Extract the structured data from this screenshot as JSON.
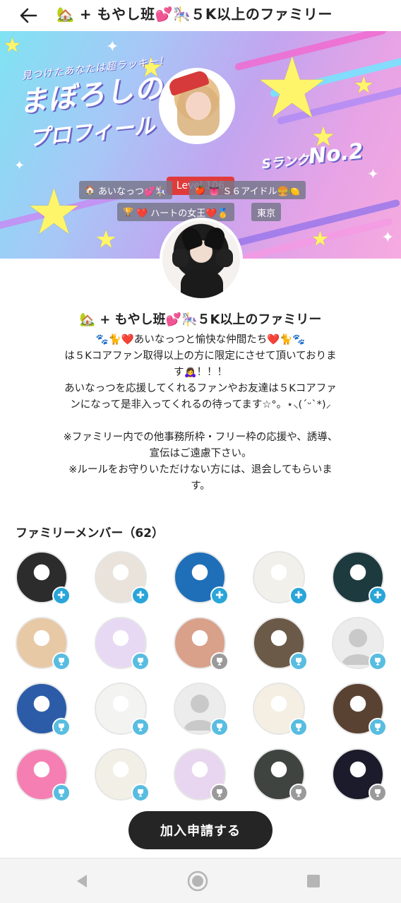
{
  "header": {
    "title": "🏡 + もやし班💕🎠５K以上のファミリー"
  },
  "banner": {
    "subtitle": "見つけたあなたは超ラッキー！",
    "title_line1": "まぼろしの",
    "title_line2": "プロフィール",
    "rank_prefix": "Sランク",
    "rank": "No.2",
    "level": "Level.106",
    "tags": [
      {
        "icon": "🏠",
        "text": "あいなっつ💕🎠"
      },
      {
        "icon": "🍎",
        "text": "👅 Ｓ６アイドル🍔🍋"
      },
      {
        "icon": "🏆",
        "text": "❤️ ハートの女王❤️🥇"
      },
      {
        "icon": "",
        "text": "東京"
      }
    ]
  },
  "family": {
    "name": "🏡 + もやし班💕🎠５K以上のファミリー",
    "description_lines": [
      "🐾🐈❤️あいなっつと愉快な仲間たち❤️🐈🐾",
      "は５Kコアファン取得以上の方に限定にさせて頂いておりま",
      "す🙇‍♀️！！！",
      "あいなっつを応援してくれるファンやお友達は５Kコアファ",
      "ンになって是非入ってくれるの待ってます☆°。⋆⸜(ˊᵕˋ*)⸝",
      "",
      "※ファミリー内での他事務所枠・フリー枠の応援や、誘導、",
      "宣伝はご遠慮下さい。",
      "※ルールをお守りいただけない方には、退会してもらいま",
      "す。"
    ]
  },
  "members": {
    "heading": "ファミリーメンバー（62）",
    "items": [
      {
        "badge": "plus",
        "bg": "#2c2c2c"
      },
      {
        "badge": "plus",
        "bg": "#e9e3dc"
      },
      {
        "badge": "plus",
        "bg": "#1f6fb8"
      },
      {
        "badge": "plus",
        "bg": "#f2f0ea"
      },
      {
        "badge": "plus",
        "bg": "#1d3a3f"
      },
      {
        "badge": "cup",
        "bg": "#e8c9a6"
      },
      {
        "badge": "cup",
        "bg": "#e7d9f4"
      },
      {
        "badge": "grey",
        "bg": "#d9a08a"
      },
      {
        "badge": "cup",
        "bg": "#6b5a48"
      },
      {
        "badge": "cup",
        "bg": "#ececec"
      },
      {
        "badge": "cup",
        "bg": "#2c5ca8"
      },
      {
        "badge": "cup",
        "bg": "#f3f3f1"
      },
      {
        "badge": "cup",
        "bg": "#ececec"
      },
      {
        "badge": "cup",
        "bg": "#f4efe2"
      },
      {
        "badge": "cup",
        "bg": "#5a4232"
      },
      {
        "badge": "cup",
        "bg": "#f57fb3"
      },
      {
        "badge": "cup",
        "bg": "#f2efe6"
      },
      {
        "badge": "grey",
        "bg": "#e8d6f0"
      },
      {
        "badge": "grey",
        "bg": "#3f4440"
      },
      {
        "badge": "grey",
        "bg": "#1b1b2b"
      }
    ]
  },
  "actions": {
    "join_label": "加入申請する"
  },
  "colors": {
    "badge_plus": "#2aa5d8",
    "badge_cup": "#58bde0",
    "level_red": "#e03b3b",
    "join_button": "#252525"
  }
}
